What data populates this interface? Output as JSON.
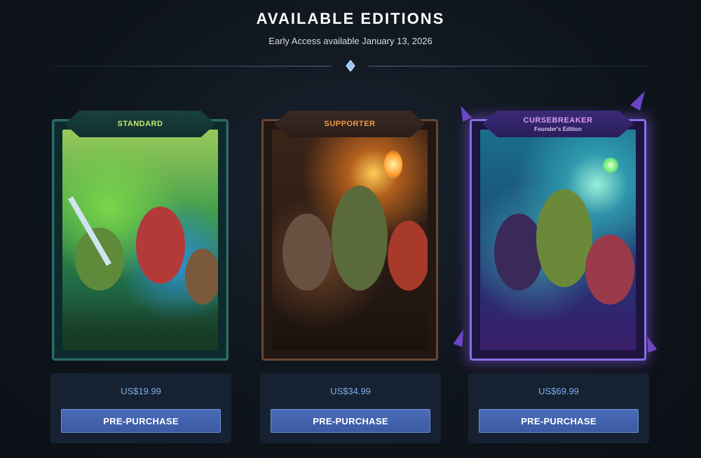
{
  "header": {
    "title": "AVAILABLE EDITIONS",
    "subtitle": "Early Access available January 13, 2026"
  },
  "editions": [
    {
      "name": "STANDARD",
      "subtitle": "",
      "price": "US$19.99",
      "button_label": "PRE-PURCHASE",
      "accent": "#c8ec71",
      "frame_color": "#2b6b6a"
    },
    {
      "name": "SUPPORTER",
      "subtitle": "",
      "price": "US$34.99",
      "button_label": "PRE-PURCHASE",
      "accent": "#f09a45",
      "frame_color": "#6b4532"
    },
    {
      "name": "CURSEBREAKER",
      "subtitle": "Founder's Edition",
      "price": "US$69.99",
      "button_label": "PRE-PURCHASE",
      "accent": "#d99cf0",
      "frame_color": "#8a6ee6"
    }
  ],
  "colors": {
    "price_text": "#79b0ee",
    "button_bg": "#4a6bb8",
    "panel_bg": "#162231"
  },
  "icons": {
    "divider": "diamond-icon"
  }
}
